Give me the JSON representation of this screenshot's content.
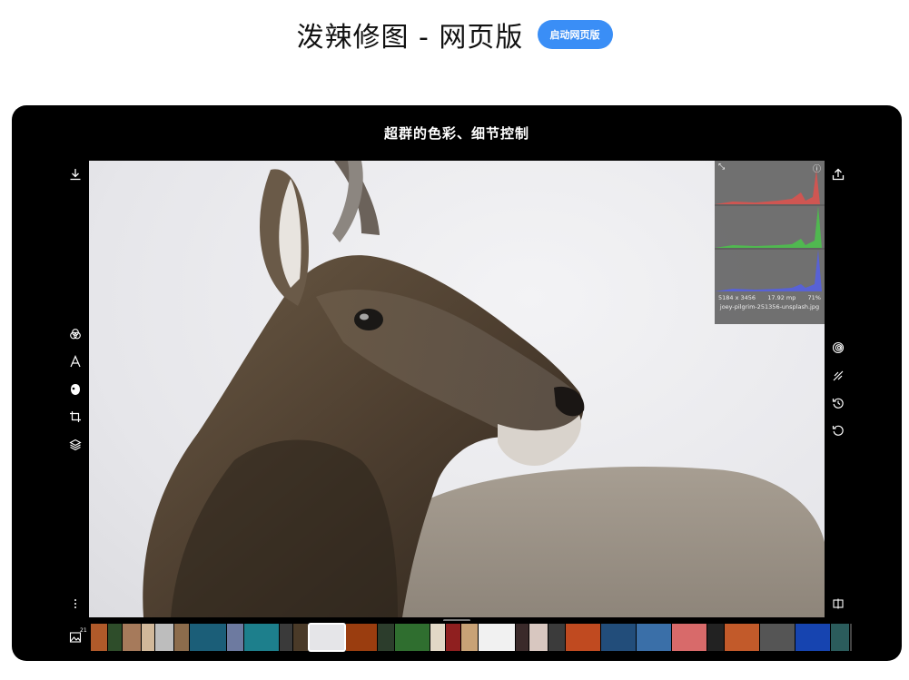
{
  "header": {
    "title": "泼辣修图 - 网页版",
    "launch_button": "启动网页版"
  },
  "device": {
    "caption": "超群的色彩、细节控制"
  },
  "left_toolbar": {
    "top": [
      {
        "icon": "download-icon"
      }
    ],
    "middle": [
      {
        "icon": "color-circles-icon"
      },
      {
        "icon": "text-a-icon"
      },
      {
        "icon": "mask-face-icon"
      },
      {
        "icon": "crop-icon"
      },
      {
        "icon": "layers-icon"
      }
    ],
    "bottom": [
      {
        "icon": "more-vertical-icon"
      },
      {
        "icon": "image-gallery-icon"
      }
    ]
  },
  "right_toolbar": {
    "top": [
      {
        "icon": "share-icon"
      }
    ],
    "middle": [
      {
        "icon": "radial-filter-icon"
      },
      {
        "icon": "compare-slash-icon"
      },
      {
        "icon": "history-icon"
      },
      {
        "icon": "undo-icon"
      }
    ],
    "bottom": [
      {
        "icon": "split-view-icon"
      }
    ]
  },
  "histogram": {
    "dimensions": "5184 x 3456",
    "megapixels": "17.92 mp",
    "zoom": "71%",
    "filename": "joey-pilgrim-251356-unsplash.jpg",
    "channels": [
      {
        "name": "red",
        "color": "#d9534f"
      },
      {
        "name": "green",
        "color": "#4cc04c"
      },
      {
        "name": "blue",
        "color": "#5561e0"
      }
    ]
  },
  "filmstrip": {
    "count_badge": "21",
    "thumbs": [
      {
        "color": "#b05a2a",
        "w": 18
      },
      {
        "color": "#2e4d2a",
        "w": 15
      },
      {
        "color": "#a67a5b",
        "w": 20
      },
      {
        "color": "#d1b89a",
        "w": 14
      },
      {
        "color": "#bdbdbd",
        "w": 20
      },
      {
        "color": "#8c6c4c",
        "w": 16
      },
      {
        "color": "#1b5e78",
        "w": 40
      },
      {
        "color": "#6d7aa0",
        "w": 18
      },
      {
        "color": "#1d7f8c",
        "w": 38
      },
      {
        "color": "#3a3a3a",
        "w": 14
      },
      {
        "color": "#4a3a28",
        "w": 16
      },
      {
        "color": "#e5e5e8",
        "w": 40,
        "selected": true
      },
      {
        "color": "#9a3d0f",
        "w": 34
      },
      {
        "color": "#2c3d2c",
        "w": 18
      },
      {
        "color": "#2f6e2f",
        "w": 38
      },
      {
        "color": "#e2d8c6",
        "w": 16
      },
      {
        "color": "#8f1f1f",
        "w": 16
      },
      {
        "color": "#c8a276",
        "w": 18
      },
      {
        "color": "#f1f1f1",
        "w": 40
      },
      {
        "color": "#3a2a2a",
        "w": 14
      },
      {
        "color": "#d8c7c0",
        "w": 20
      },
      {
        "color": "#3b3b3b",
        "w": 18
      },
      {
        "color": "#c04a20",
        "w": 38
      },
      {
        "color": "#224d7a",
        "w": 38
      },
      {
        "color": "#3a6fa8",
        "w": 38
      },
      {
        "color": "#d86a6a",
        "w": 38
      },
      {
        "color": "#222222",
        "w": 18
      },
      {
        "color": "#c25a2a",
        "w": 38
      },
      {
        "color": "#555555",
        "w": 38
      },
      {
        "color": "#1644b0",
        "w": 38
      },
      {
        "color": "#2b5c5c",
        "w": 20
      },
      {
        "color": "#444444",
        "w": 28
      }
    ]
  }
}
